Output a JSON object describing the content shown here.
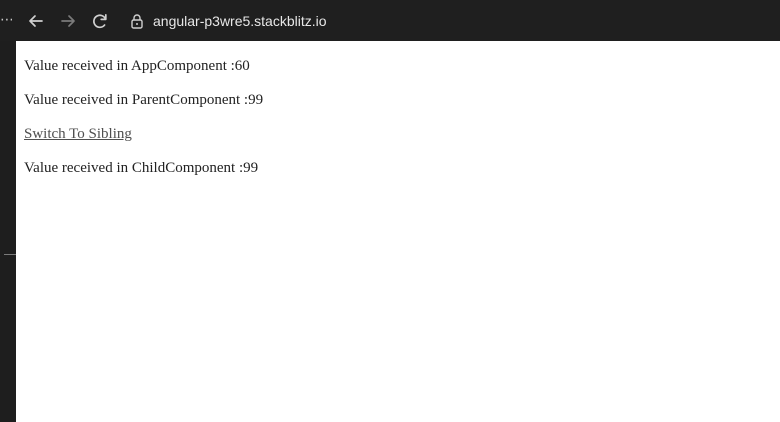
{
  "browser": {
    "overflow_icon": "more-dots-icon",
    "back_icon": "back-arrow-icon",
    "forward_icon": "forward-arrow-icon",
    "reload_icon": "reload-icon",
    "lock_icon": "lock-icon",
    "url": "angular-p3wre5.stackblitz.io"
  },
  "page": {
    "app_value_text": "Value received in AppComponent :60",
    "parent_value_text": "Value received in ParentComponent :99",
    "switch_link": "Switch To Sibling",
    "child_value_text": "Value received in ChildComponent :99"
  },
  "colors": {
    "browser_chrome": "#1f1f1f",
    "page_background": "#ffffff",
    "page_text": "#222222",
    "link_text": "#4f4f4f"
  }
}
